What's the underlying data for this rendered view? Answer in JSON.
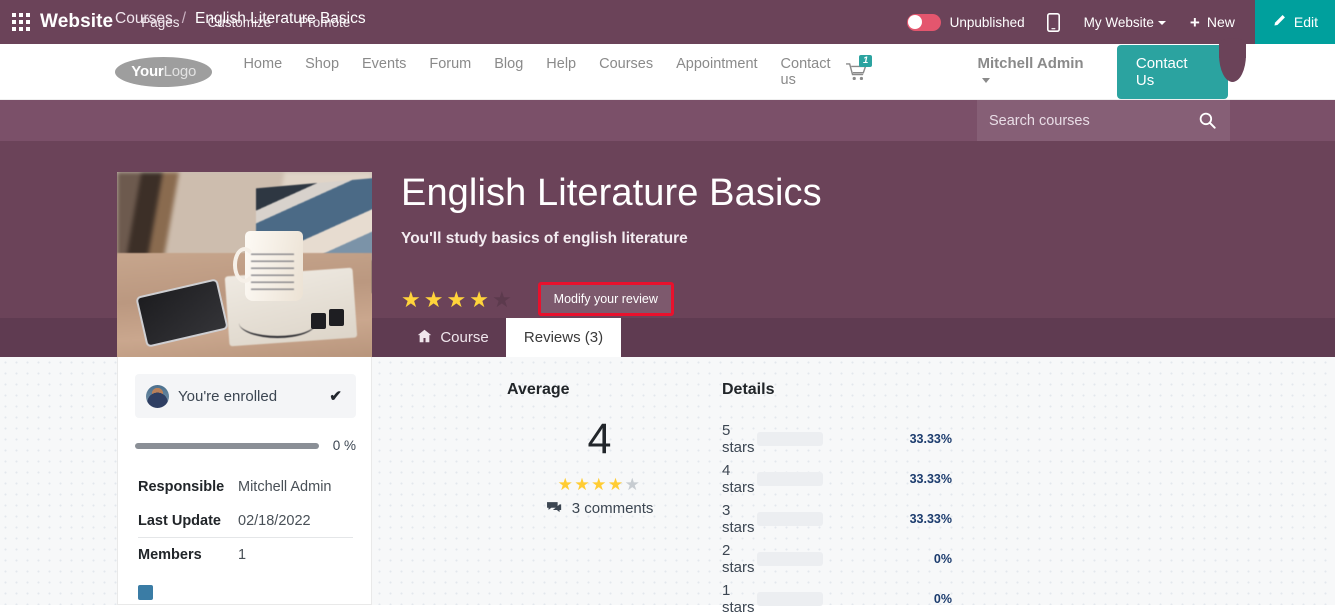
{
  "topbar": {
    "apps_icon": "apps-grid-icon",
    "app_title": "Website",
    "menu": [
      {
        "label": "Pages"
      },
      {
        "label": "Customize"
      },
      {
        "label": "Promote"
      }
    ],
    "publish_toggle_label": "Unpublished",
    "publish_toggle_state": "off",
    "mobile_icon": "mobile-preview-icon",
    "my_website_label": "My Website",
    "new_label": "New",
    "new_icon": "plus-icon",
    "edit_label": "Edit",
    "edit_icon": "pencil-icon",
    "edit_color": "#00a09d",
    "bar_color": "#6b4359"
  },
  "site_header": {
    "logo_bold": "Your",
    "logo_light": "Logo",
    "nav": [
      {
        "label": "Home"
      },
      {
        "label": "Shop"
      },
      {
        "label": "Events"
      },
      {
        "label": "Forum"
      },
      {
        "label": "Blog"
      },
      {
        "label": "Help"
      },
      {
        "label": "Courses"
      },
      {
        "label": "Appointment"
      },
      {
        "label": "Contact us"
      }
    ],
    "cart_icon": "shopping-cart-icon",
    "cart_count": "1",
    "user_label": "Mitchell Admin",
    "contact_label": "Contact Us",
    "accent_color": "#2ba3a0"
  },
  "breadcrumb": {
    "parent": "Courses",
    "separator": "/",
    "current": "English Literature Basics"
  },
  "search": {
    "placeholder": "Search courses",
    "value": "",
    "icon": "search-icon"
  },
  "hero": {
    "image_alt": "course-cover-image",
    "title": "English Literature Basics",
    "subtitle": "You'll study basics of english literature",
    "rating_filled": 4,
    "rating_total": 5,
    "modify_label": "Modify your review",
    "highlight_color": "#e8112d",
    "bg_color": "#6b4359"
  },
  "tabs": [
    {
      "label": "Course",
      "icon": "home-icon",
      "active": false
    },
    {
      "label": "Reviews (3)",
      "icon": "",
      "active": true
    }
  ],
  "sidebar": {
    "enrolled_label": "You're enrolled",
    "enrolled_check_icon": "check-icon",
    "avatar_icon": "user-avatar",
    "progress_percent": "0 %",
    "progress_value": 0,
    "info": [
      {
        "key": "Responsible",
        "value": "Mitchell Admin"
      },
      {
        "key": "Last Update",
        "value": "02/18/2022"
      },
      {
        "key": "Members",
        "value": "1"
      }
    ]
  },
  "average": {
    "title": "Average",
    "score": "4",
    "stars_filled": 4,
    "stars_total": 5,
    "comments_label": "3 comments",
    "comments_icon": "comments-icon"
  },
  "details": {
    "title": "Details",
    "rows": [
      {
        "label": "5 stars",
        "percent": "33.33%",
        "value": 33.33
      },
      {
        "label": "4 stars",
        "percent": "33.33%",
        "value": 33.33
      },
      {
        "label": "3 stars",
        "percent": "33.33%",
        "value": 33.33
      },
      {
        "label": "2 stars",
        "percent": "0%",
        "value": 0
      },
      {
        "label": "1 stars",
        "percent": "0%",
        "value": 0
      }
    ]
  }
}
